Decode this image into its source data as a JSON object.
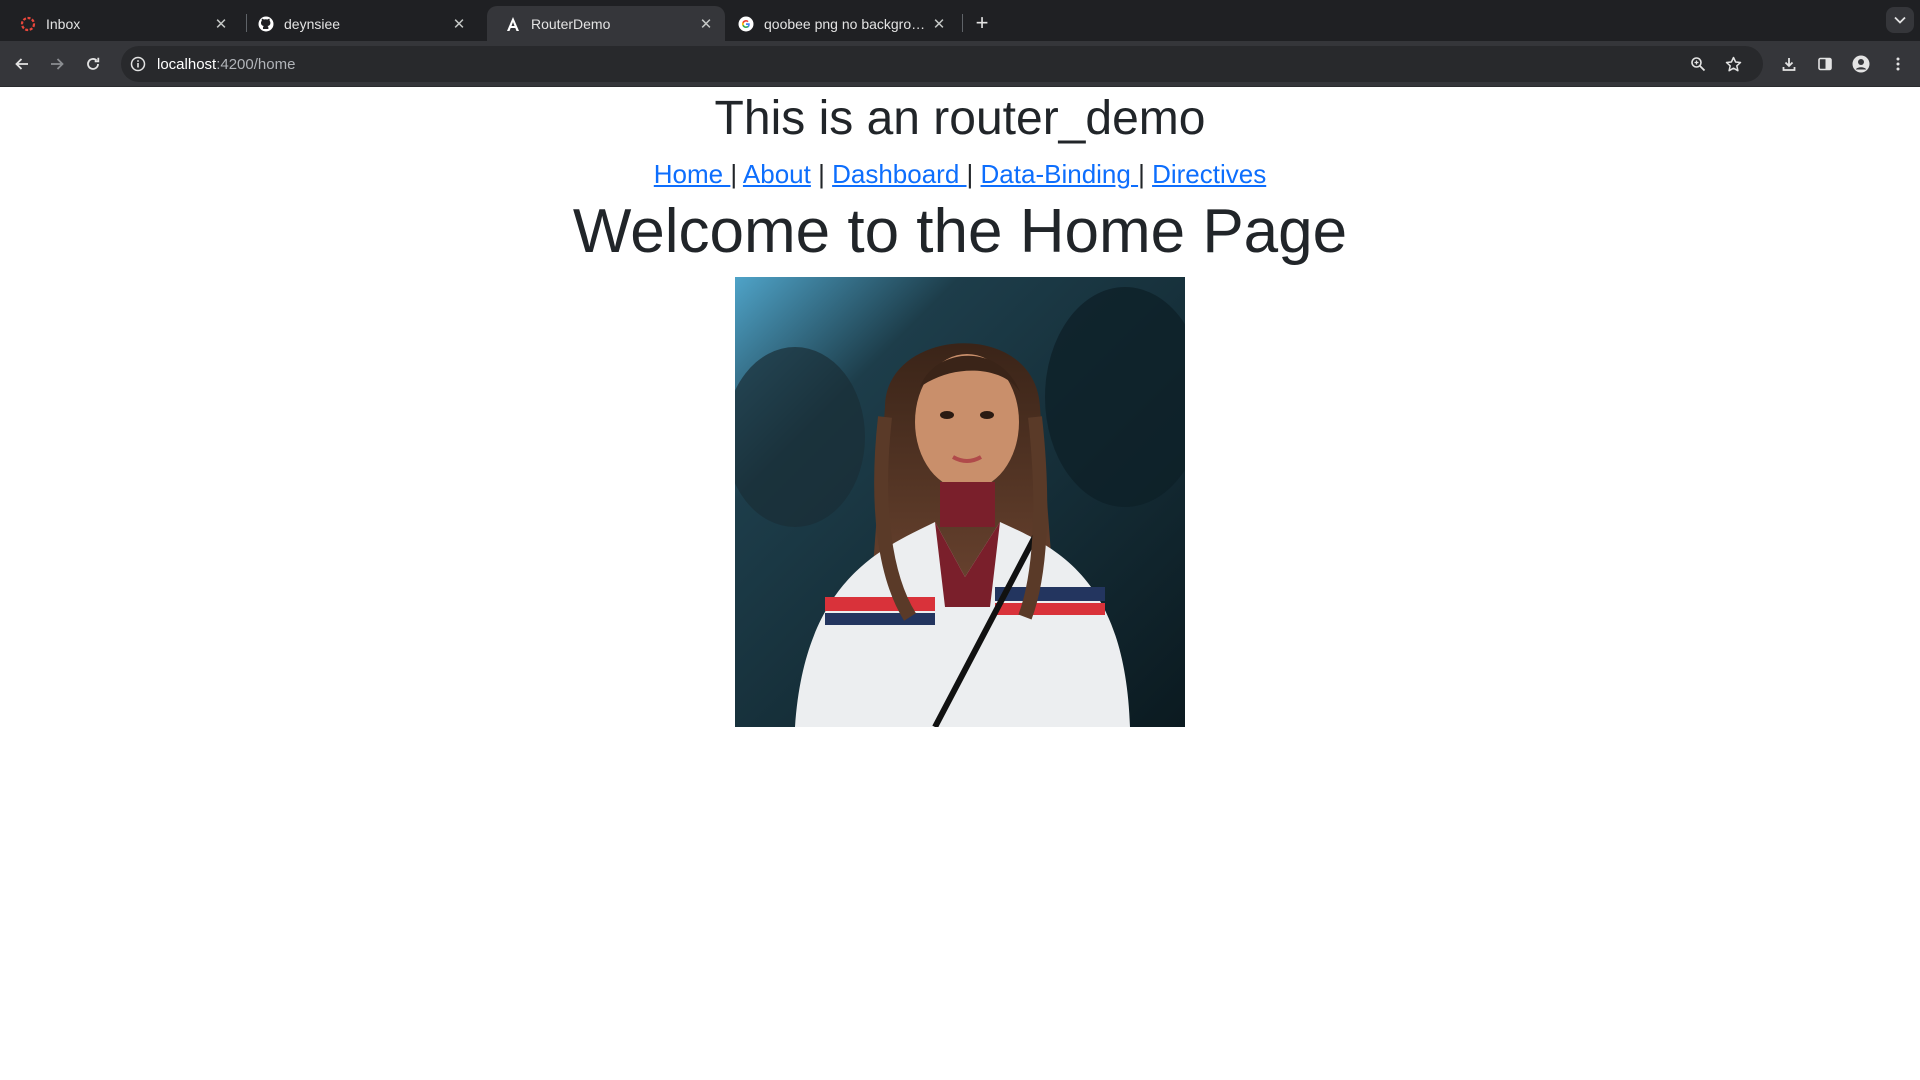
{
  "browser": {
    "tabs": [
      {
        "title": "Inbox",
        "icon": "inbox-favicon-icon",
        "active": false
      },
      {
        "title": "deynsiee",
        "icon": "github-icon",
        "active": false
      },
      {
        "title": "RouterDemo",
        "icon": "angular-icon",
        "active": true
      },
      {
        "title": "qoobee png no background -",
        "icon": "google-icon",
        "active": false
      }
    ],
    "new_tab": "+",
    "address": {
      "host": "localhost",
      "path": ":4200/home"
    }
  },
  "page": {
    "app_title": "This is an router_demo",
    "nav": [
      {
        "label": "Home "
      },
      {
        "label": "About"
      },
      {
        "label": "Dashboard "
      },
      {
        "label": "Data-Binding "
      },
      {
        "label": "Directives"
      }
    ],
    "separator": "|",
    "heading": "Welcome to the Home Page"
  },
  "colors": {
    "link": "#0d6efd",
    "text": "#212529",
    "chrome_dark": "#1f2023",
    "chrome_toolbar": "#35363a"
  }
}
